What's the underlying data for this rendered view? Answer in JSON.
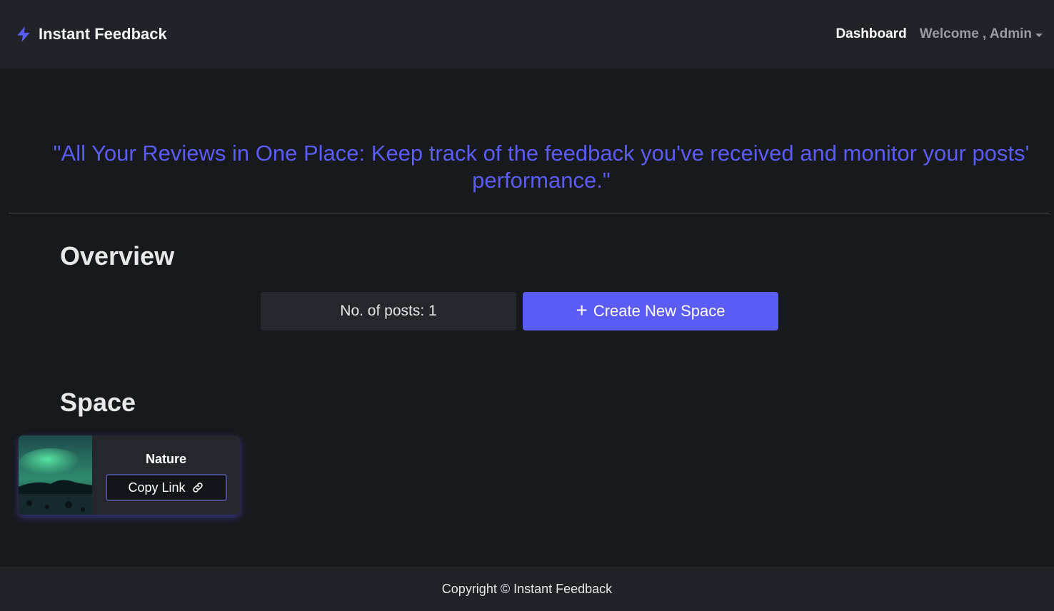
{
  "navbar": {
    "brand": "Instant Feedback",
    "dashboard_label": "Dashboard",
    "user_label": "Welcome , Admin"
  },
  "tagline": "\"All Your Reviews in One Place: Keep track of the feedback you've received and monitor your posts' performance.\"",
  "overview": {
    "heading": "Overview",
    "posts_stat": "No. of posts: 1",
    "create_label": "Create New Space"
  },
  "space": {
    "heading": "Space",
    "cards": [
      {
        "title": "Nature",
        "copy_label": "Copy Link"
      }
    ]
  },
  "footer": {
    "text": "Copyright © Instant Feedback"
  },
  "colors": {
    "accent": "#5b5bf5",
    "background": "#18191c",
    "navbar": "#212329"
  },
  "icons": [
    "bolt-icon",
    "chevron-down-icon",
    "plus-icon",
    "link-icon"
  ]
}
